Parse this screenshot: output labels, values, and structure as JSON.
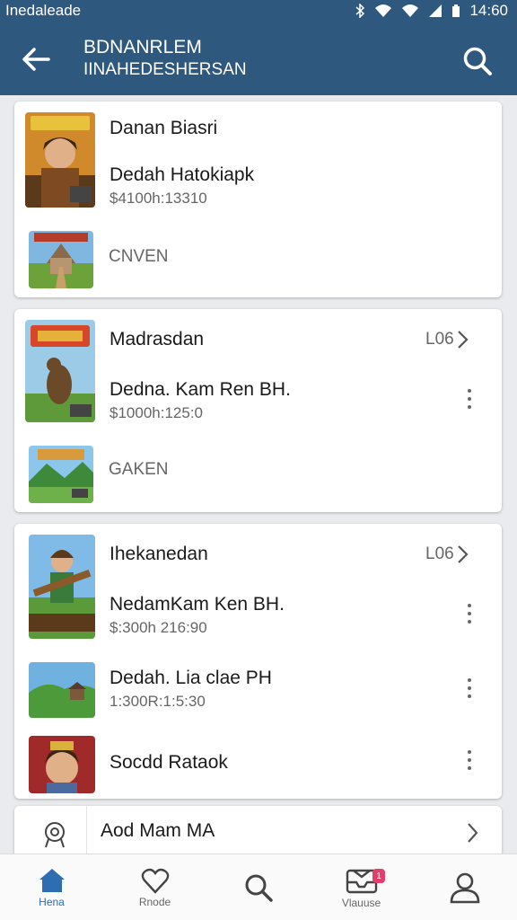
{
  "status_bar": {
    "carrier": "Inedaleade",
    "time": "14:60"
  },
  "app_bar": {
    "title": "BDNANRLEM",
    "subtitle": "IINAHEDESHERSAN"
  },
  "cards": [
    {
      "items": [
        {
          "name": "Danan Biasri"
        },
        {
          "name": "Dedah Hatokiapk",
          "price": "$4100h:13310"
        },
        {
          "label": "CNVEN"
        }
      ]
    },
    {
      "header_link": "L06",
      "items": [
        {
          "name": "Madrasdan"
        },
        {
          "name": "Dedna. Kam Ren BH.",
          "price": "$1000h:125:0"
        },
        {
          "label": "GAKEN"
        }
      ]
    },
    {
      "header_link": "L06",
      "items": [
        {
          "name": "Ihekanedan"
        },
        {
          "name": "NedamKam Ken BH.",
          "price": "$:300h 216:90"
        },
        {
          "name": "Dedah. Lia clae PH",
          "price": "1:300R:1:5:30"
        },
        {
          "name": "Socdd Rataok"
        }
      ]
    }
  ],
  "bottom_card": {
    "label": "Aod Mam MA"
  },
  "bottom_nav": [
    {
      "label": "Hena",
      "icon": "home-icon",
      "active": true
    },
    {
      "label": "Rnode",
      "icon": "heart-icon"
    },
    {
      "label": "",
      "icon": "search-icon"
    },
    {
      "label": "Vlauuse",
      "icon": "inbox-icon",
      "badge": "1"
    },
    {
      "label": "",
      "icon": "profile-icon"
    }
  ],
  "colors": {
    "app_bar": "#2e587e",
    "active_nav": "#2e6db0",
    "badge": "#e23d6b"
  }
}
